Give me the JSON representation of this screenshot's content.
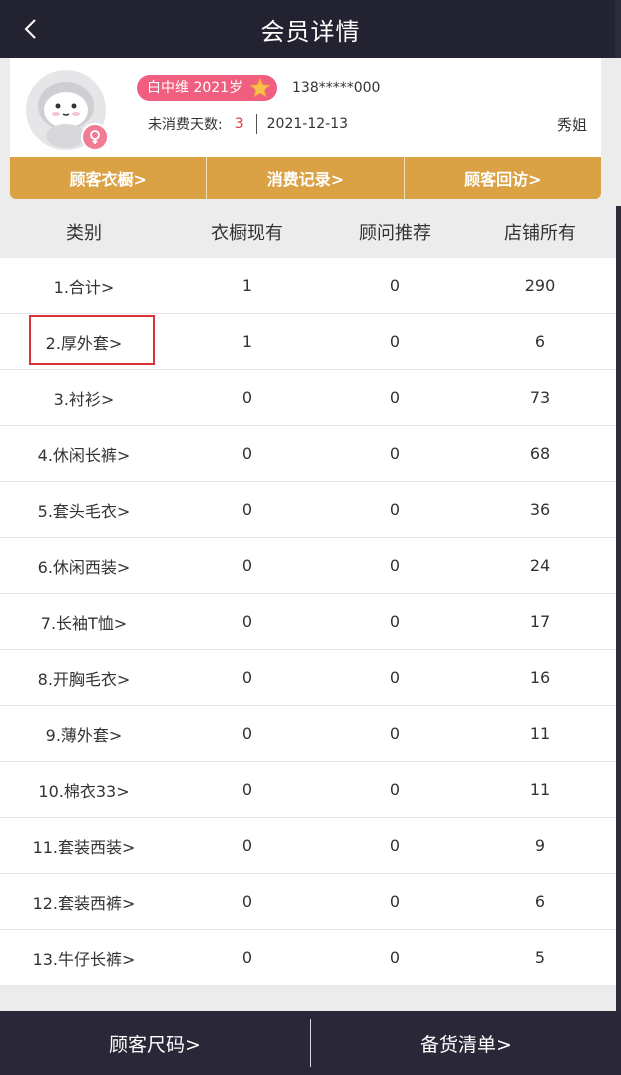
{
  "header": {
    "title": "会员详情"
  },
  "profile": {
    "member_name": "白中维 2021岁",
    "phone": "138*****000",
    "days_label": "未消费天数:",
    "days_value": "3",
    "last_date": "2021-12-13",
    "advisor": "秀姐"
  },
  "actions": [
    "顾客衣橱>",
    "消费记录>",
    "顾客回访>"
  ],
  "table": {
    "headers": [
      "类别",
      "衣橱现有",
      "顾问推荐",
      "店铺所有"
    ],
    "rows": [
      {
        "category": "1.合计>",
        "wardrobe": "1",
        "recommend": "0",
        "store": "290"
      },
      {
        "category": "2.厚外套>",
        "wardrobe": "1",
        "recommend": "0",
        "store": "6"
      },
      {
        "category": "3.衬衫>",
        "wardrobe": "0",
        "recommend": "0",
        "store": "73"
      },
      {
        "category": "4.休闲长裤>",
        "wardrobe": "0",
        "recommend": "0",
        "store": "68"
      },
      {
        "category": "5.套头毛衣>",
        "wardrobe": "0",
        "recommend": "0",
        "store": "36"
      },
      {
        "category": "6.休闲西装>",
        "wardrobe": "0",
        "recommend": "0",
        "store": "24"
      },
      {
        "category": "7.长袖T恤>",
        "wardrobe": "0",
        "recommend": "0",
        "store": "17"
      },
      {
        "category": "8.开胸毛衣>",
        "wardrobe": "0",
        "recommend": "0",
        "store": "16"
      },
      {
        "category": "9.薄外套>",
        "wardrobe": "0",
        "recommend": "0",
        "store": "11"
      },
      {
        "category": "10.棉衣33>",
        "wardrobe": "0",
        "recommend": "0",
        "store": "11"
      },
      {
        "category": "11.套装西装>",
        "wardrobe": "0",
        "recommend": "0",
        "store": "9"
      },
      {
        "category": "12.套装西裤>",
        "wardrobe": "0",
        "recommend": "0",
        "store": "6"
      },
      {
        "category": "13.牛仔长裤>",
        "wardrobe": "0",
        "recommend": "0",
        "store": "5"
      }
    ]
  },
  "bottom": {
    "size_label": "顾客尺码>",
    "stock_label": "备货清单>"
  },
  "colors": {
    "accent_gold": "#daa244",
    "tag_pink": "#f05f7f",
    "days_red": "#e23b3b",
    "highlight_red": "#d9333a"
  },
  "icons": {
    "back": "chevron-left-icon",
    "star": "star-icon",
    "gender": "female-icon",
    "avatar": "avatar"
  }
}
